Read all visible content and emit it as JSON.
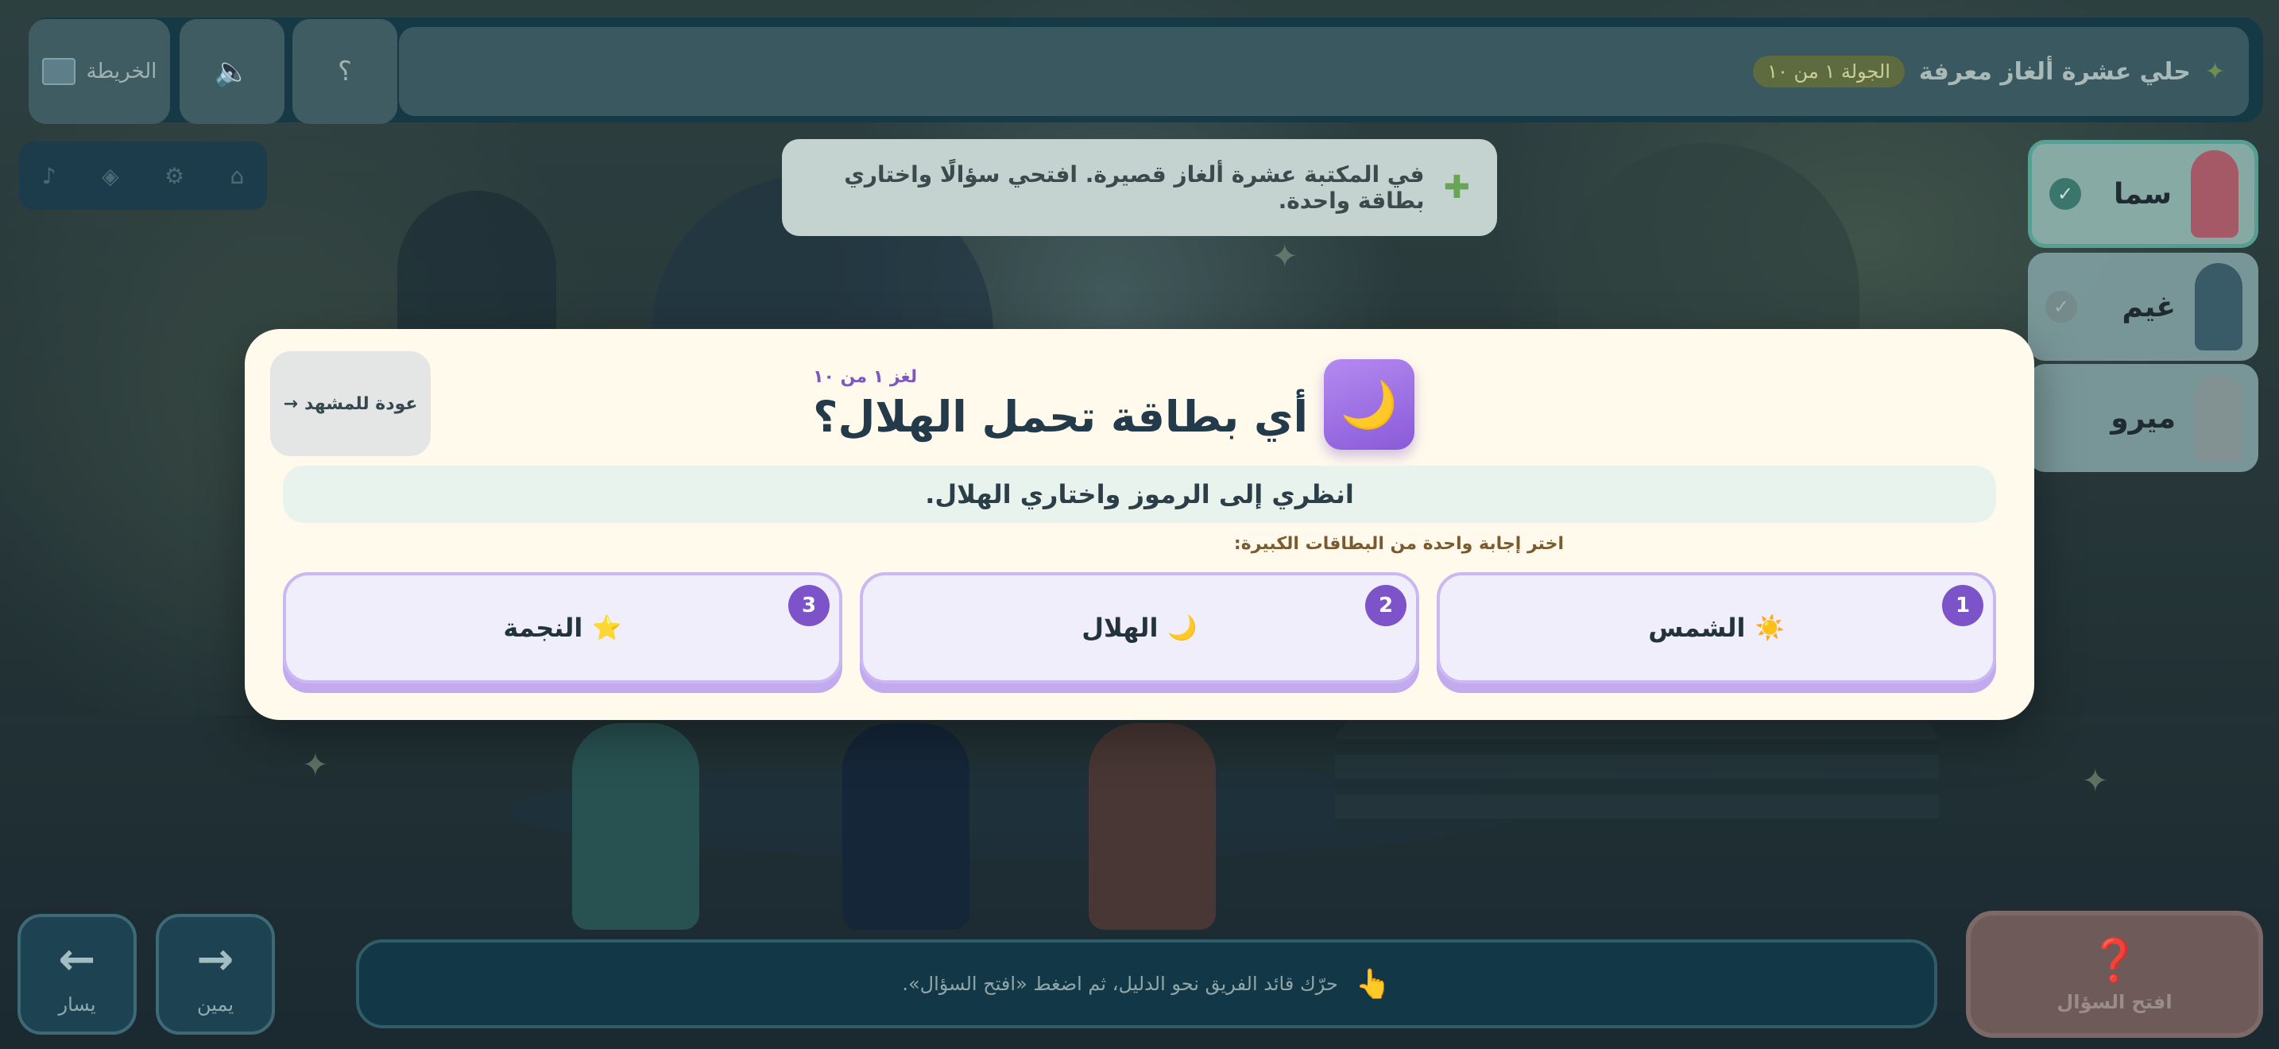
{
  "header": {
    "title": "حلي عشرة ألغاز معرفة",
    "round": "الجولة ١ من ١٠",
    "map_label": "الخريطة",
    "help_label": "؟"
  },
  "hint": {
    "text": "في المكتبة عشرة ألغاز قصيرة. افتحي سؤالًا واختاري بطاقة واحدة."
  },
  "players": [
    {
      "name": "سما",
      "status": "✓"
    },
    {
      "name": "غيم",
      "status": "✓"
    },
    {
      "name": "ميرو",
      "status": ""
    }
  ],
  "modal": {
    "back_label": "عودة للمشهد",
    "back_arrow": "→",
    "counter": "لغز ١ من ١٠",
    "question": "أي بطاقة تحمل الهلال؟",
    "icon": "🌙",
    "prompt": "انظري إلى الرموز واختاري الهلال.",
    "sublabel": "اختر إجابة واحدة من البطاقات الكبيرة:",
    "options": [
      {
        "num": "1",
        "emoji": "☀️",
        "label": "الشمس"
      },
      {
        "num": "2",
        "emoji": "🌙",
        "label": "الهلال"
      },
      {
        "num": "3",
        "emoji": "⭐",
        "label": "النجمة"
      }
    ]
  },
  "controls": {
    "left_label": "يسار",
    "right_label": "يمين",
    "left_arrow": "←",
    "right_arrow": "→",
    "instruction": "حرّك قائد الفريق نحو الدليل، ثم اضغط «افتح السؤال».",
    "open_question_label": "افتح السؤال",
    "open_question_icon": "❓"
  }
}
